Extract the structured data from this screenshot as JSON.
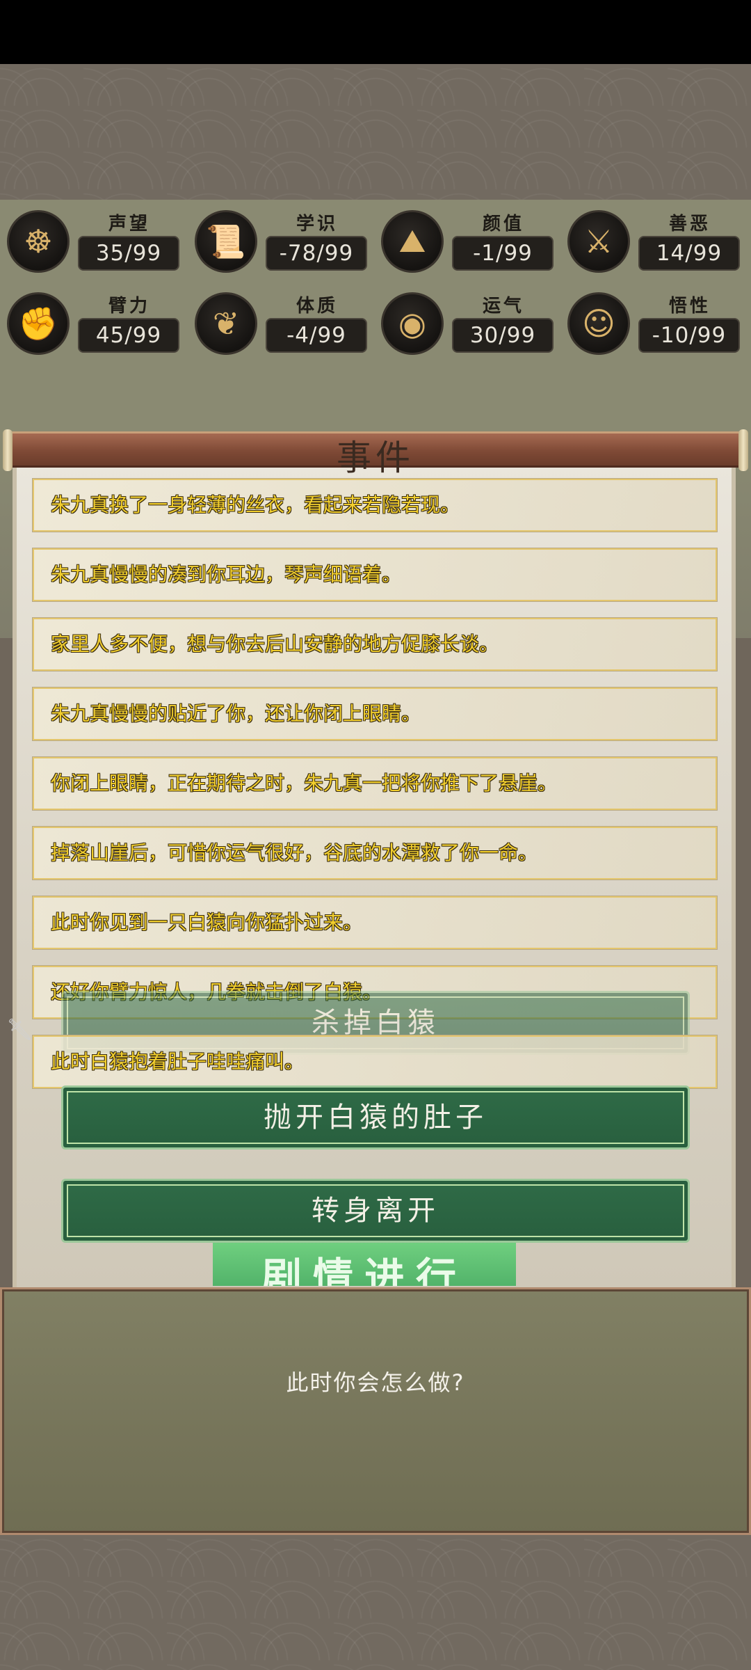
{
  "stats": [
    {
      "name": "声望",
      "value": "35/99",
      "icon": "guardian-statue-icon"
    },
    {
      "name": "学识",
      "value": "-78/99",
      "icon": "scroll-book-icon"
    },
    {
      "name": "颜值",
      "value": "-1/99",
      "icon": "straw-hat-icon"
    },
    {
      "name": "善恶",
      "value": "14/99",
      "icon": "crossed-swords-icon"
    },
    {
      "name": "臂力",
      "value": "45/99",
      "icon": "fist-icon"
    },
    {
      "name": "体质",
      "value": "-4/99",
      "icon": "meditating-figure-icon"
    },
    {
      "name": "运气",
      "value": "30/99",
      "icon": "gold-ingot-icon"
    },
    {
      "name": "悟性",
      "value": "-10/99",
      "icon": "head-profile-icon"
    }
  ],
  "event_title": "事件",
  "log": [
    "朱九真换了一身轻薄的丝衣，看起来若隐若现。",
    "朱九真慢慢的凑到你耳边，琴声细语着。",
    "家里人多不便，想与你去后山安静的地方促膝长谈。",
    "朱九真慢慢的贴近了你，还让你闭上眼睛。",
    "你闭上眼睛，正在期待之时，朱九真一把将你推下了悬崖。",
    "掉落山崖后，可惜你运气很好，谷底的水潭救了你一命。",
    "此时你见到一只白猿向你猛扑过来。",
    "还好你臂力惊人，几拳就击倒了白猿。",
    "此时白猿抱着肚子哇哇痛叫。"
  ],
  "choices": [
    "杀掉白猿",
    "抛开白猿的肚子",
    "转身离开"
  ],
  "progress_label": "剧情进行",
  "prompt": "此时你会怎么做?",
  "colors": {
    "log_text": "#f2cf2e",
    "choice_bg": "#2f6b47",
    "rod": "#7f4a36",
    "progress": "#5fbf72"
  }
}
